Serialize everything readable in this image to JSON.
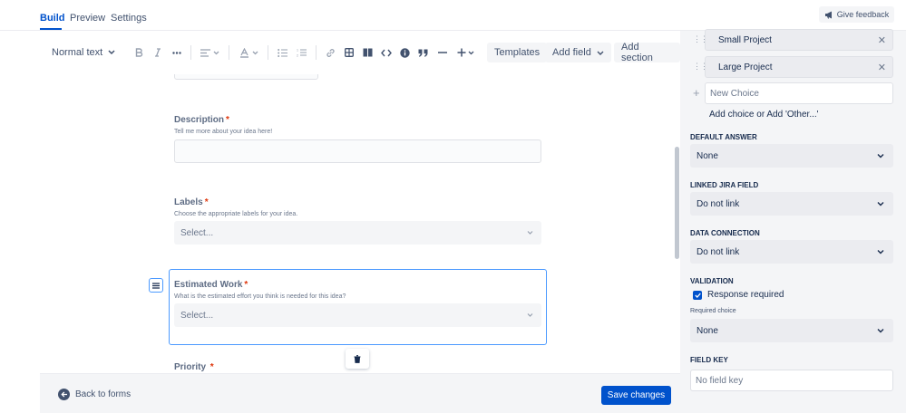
{
  "tabs": [
    {
      "label": "Build",
      "active": true
    },
    {
      "label": "Preview",
      "active": false
    },
    {
      "label": "Settings",
      "active": false
    }
  ],
  "feedback": {
    "label": "Give feedback"
  },
  "toolbar": {
    "text_style": "Normal text",
    "templates": "Templates",
    "add_field": "Add field",
    "add_section": "Add section"
  },
  "form": {
    "description": {
      "label": "Description",
      "required_mark": "*",
      "help": "Tell me more about your idea here!"
    },
    "labels": {
      "label": "Labels",
      "required_mark": "*",
      "help": "Choose the appropriate labels for your idea.",
      "placeholder": "Select..."
    },
    "estimated_work": {
      "label": "Estimated Work",
      "required_mark": "*",
      "help": "What is the estimated effort you think is needed for this idea?",
      "placeholder": "Select..."
    },
    "priority": {
      "label": "Priority",
      "required_mark": "*"
    }
  },
  "bottom": {
    "back": "Back to forms",
    "save": "Save changes"
  },
  "panel": {
    "choices": [
      "Small Project",
      "Large Project"
    ],
    "new_choice_placeholder": "New Choice",
    "add_hint": "Add choice or Add 'Other...'",
    "default_answer": {
      "label": "DEFAULT ANSWER",
      "value": "None"
    },
    "linked_jira": {
      "label": "LINKED JIRA FIELD",
      "value": "Do not link"
    },
    "data_connection": {
      "label": "DATA CONNECTION",
      "value": "Do not link"
    },
    "validation": {
      "label": "VALIDATION",
      "response_required": "Response required",
      "required_choice_label": "Required choice",
      "required_choice_value": "None"
    },
    "field_key": {
      "label": "FIELD KEY",
      "placeholder": "No field key"
    }
  },
  "colors": {
    "accent": "#0052cc",
    "required": "#de350b",
    "selection_border": "#4c9aff",
    "panel_bg": "#f4f5f7"
  },
  "icons": [
    "megaphone-icon",
    "chevron-down-icon",
    "bold-icon",
    "italic-icon",
    "more-icon",
    "align-icon",
    "text-color-icon",
    "bullet-list-icon",
    "numbered-list-icon",
    "link-icon",
    "table-icon",
    "layout-icon",
    "code-icon",
    "info-icon",
    "quote-icon",
    "divider-icon",
    "plus-icon",
    "drag-handle-icon",
    "close-icon",
    "trash-icon",
    "back-arrow-icon",
    "checkmark-icon"
  ]
}
